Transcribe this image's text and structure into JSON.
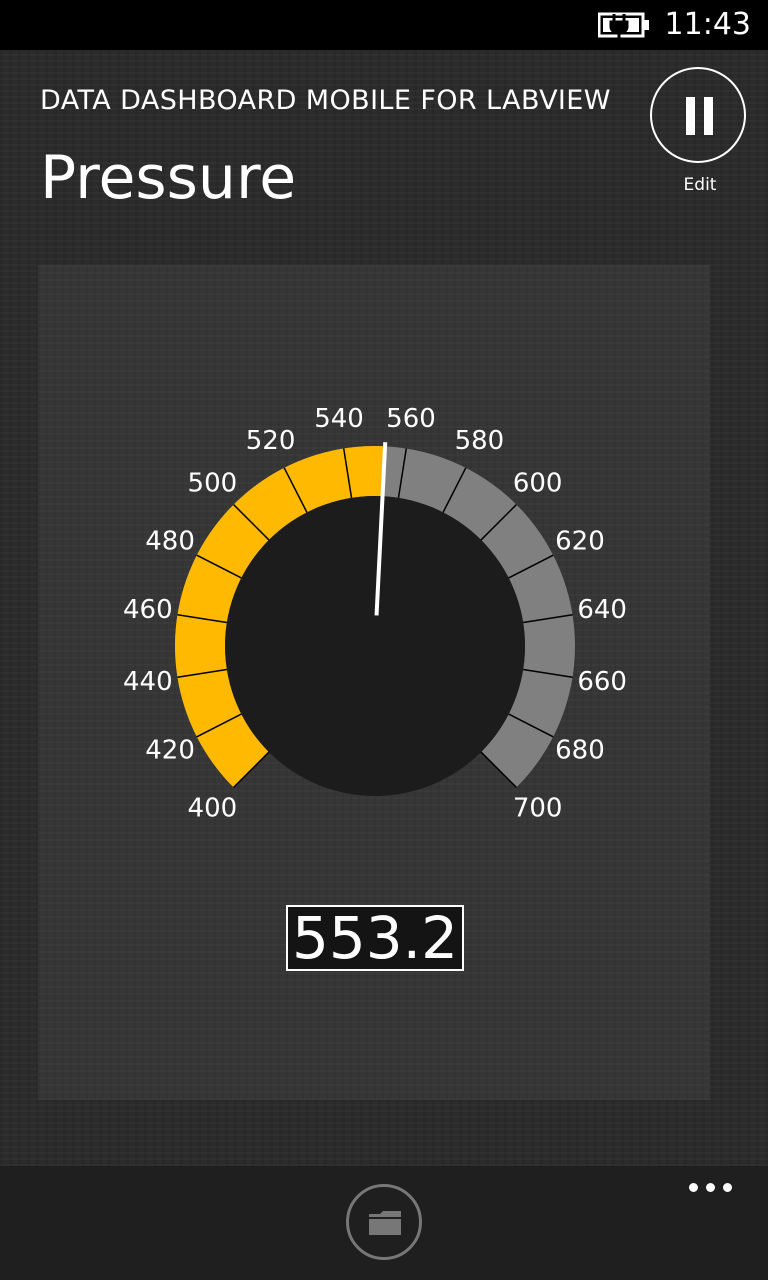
{
  "status_bar": {
    "time": "11:43",
    "battery_icon": "battery-charging-icon"
  },
  "header": {
    "app_title": "DATA DASHBOARD MOBILE FOR LABVIEW",
    "page_title": "Pressure",
    "pause_icon": "pause-icon",
    "edit_label": "Edit"
  },
  "gauge": {
    "min": 400,
    "max": 700,
    "value": 553.2,
    "value_text": "553.2",
    "tick_labels": [
      "400",
      "420",
      "440",
      "460",
      "480",
      "500",
      "520",
      "540",
      "560",
      "580",
      "600",
      "620",
      "640",
      "660",
      "680",
      "700"
    ],
    "colors": {
      "fill": "#ffb900",
      "track": "#808080",
      "face": "#1c1c1c",
      "needle": "#ffffff"
    }
  },
  "app_bar": {
    "folder_icon": "folder-icon",
    "more_icon": "more-ellipsis-icon"
  }
}
